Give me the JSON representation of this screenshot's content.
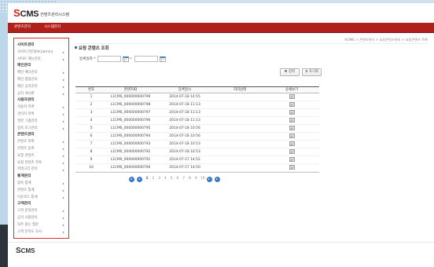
{
  "header": {
    "logo_s": "S",
    "logo_cms": "CMS",
    "subtitle": "컨텐츠관리시스템"
  },
  "nav": {
    "items": [
      "콘텐츠관리",
      "시스템관리"
    ]
  },
  "sidebar": {
    "items": [
      {
        "label": "사이트관리",
        "header": true
      },
      {
        "label": "사이트기본정보(admin)"
      },
      {
        "label": "사이트 메뉴관리"
      },
      {
        "label": "메인관리",
        "header": true
      },
      {
        "label": "메인 배너관리"
      },
      {
        "label": "메인 팝업관리"
      },
      {
        "label": "메인 공지관리"
      },
      {
        "label": "공지 게시판"
      },
      {
        "label": "사용자관리",
        "header": true
      },
      {
        "label": "사용자 목록"
      },
      {
        "label": "관리자 목록"
      },
      {
        "label": "권한 그룹관리"
      },
      {
        "label": "접속 로그관리"
      },
      {
        "label": "콘텐츠관리",
        "header": true
      },
      {
        "label": "콘텐츠 목록"
      },
      {
        "label": "콘텐츠 등록"
      },
      {
        "label": "요청 콘텐츠"
      },
      {
        "label": "요청 콘텐츠 목록"
      },
      {
        "label": "카테고리 관리"
      },
      {
        "label": "통계관리",
        "header": true
      },
      {
        "label": "접속 통계"
      },
      {
        "label": "콘텐츠 통계"
      },
      {
        "label": "다운로드 통계"
      },
      {
        "label": "고객관리",
        "header": true
      },
      {
        "label": "고객 문의관리"
      },
      {
        "label": "공지 사항관리"
      },
      {
        "label": "자주 묻는 질문"
      },
      {
        "label": "고객 만족도 조사"
      }
    ]
  },
  "main": {
    "breadcrumb": "HOME > 콘텐츠관리 > 요청콘텐츠관리 > 요청콘텐츠 목록",
    "title": "요청 콘텐츠 조회",
    "filter": {
      "label": "등록일자 *",
      "start_value": "",
      "end_value": "",
      "separator": "~"
    },
    "buttons": {
      "search": "검색",
      "reset": "초기화"
    },
    "table": {
      "columns": [
        "번호",
        "콘텐츠ID",
        "등록일시",
        "처리상태",
        "상세보기"
      ],
      "rows": [
        {
          "no": "1",
          "id": "L1CMS_000000000799",
          "date": "2014-07-18 14:55"
        },
        {
          "no": "2",
          "id": "L1CMS_000000000798",
          "date": "2014-07-18 11:13"
        },
        {
          "no": "3",
          "id": "L1CMS_000000000797",
          "date": "2014-07-18 11:13"
        },
        {
          "no": "4",
          "id": "L1CMS_000000000796",
          "date": "2014-07-18 11:13"
        },
        {
          "no": "5",
          "id": "L1CMS_000000000795",
          "date": "2014-07-18 10:56"
        },
        {
          "no": "6",
          "id": "L1CMS_000000000794",
          "date": "2014-07-18 10:56"
        },
        {
          "no": "7",
          "id": "L1CMS_000000000793",
          "date": "2014-07-18 10:53"
        },
        {
          "no": "8",
          "id": "L1CMS_000000000792",
          "date": "2014-07-18 10:53"
        },
        {
          "no": "9",
          "id": "L1CMS_000000000791",
          "date": "2014-07-17 14:52"
        },
        {
          "no": "10",
          "id": "L1CMS_000000000790",
          "date": "2014-07-17 14:50"
        }
      ]
    },
    "pagination": {
      "pages": [
        "1",
        "2",
        "3",
        "4",
        "5",
        "6",
        "7",
        "8",
        "9",
        "10"
      ],
      "current": "1"
    }
  },
  "footer": {
    "logo_s": "S",
    "logo_cms": "CMS"
  },
  "icons": {
    "calendar": "calendar-icon",
    "detail": "view-detail-icon",
    "search": "search-icon",
    "reset": "reset-icon",
    "sidebar_arrow": "chevron-right-icon"
  },
  "colors": {
    "brand_red": "#cf221b",
    "nav_red": "#b0201b",
    "sidebar_border": "#d9302a",
    "pagination_blue": "#3b78c4",
    "title_bullet": "#3b6fb5"
  }
}
